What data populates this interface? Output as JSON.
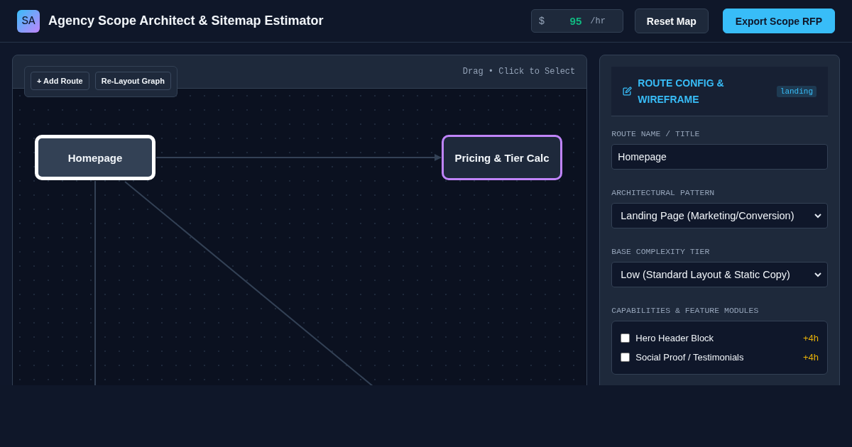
{
  "app": {
    "logo": "SA",
    "title": "Agency Scope Architect & Sitemap Estimator"
  },
  "rate": {
    "currency": "$",
    "value": "95",
    "unit": "/hr"
  },
  "header_buttons": [
    {
      "label": "Reset Map",
      "kind": "secondary"
    },
    {
      "label": "Export Scope RFP",
      "kind": "primary"
    }
  ],
  "canvas": {
    "hint": "Drag • Click to Select",
    "toolbar": [
      "+ Add Route",
      "Re-Layout Graph"
    ],
    "nodes": [
      {
        "label": "Homepage",
        "selected": true,
        "color": "#334155"
      },
      {
        "label": "Pricing & Tier Calc",
        "selected": false,
        "color": "#c084fc"
      }
    ]
  },
  "config": {
    "title": "ROUTE CONFIG & WIREFRAME",
    "badge": "landing",
    "fields": [
      {
        "label": "ROUTE NAME / TITLE",
        "kind": "text",
        "value": "Homepage"
      },
      {
        "label": "ARCHITECTURAL PATTERN",
        "kind": "select",
        "value": "Landing Page (Marketing/Conversion)"
      },
      {
        "label": "BASE COMPLEXITY TIER",
        "kind": "select",
        "value": "Low (Standard Layout & Static Copy)"
      }
    ],
    "modules_label": "CAPABILITIES & FEATURE MODULES",
    "modules": [
      {
        "label": "Hero Header Block",
        "hours": "+4h",
        "checked": false
      },
      {
        "label": "Social Proof / Testimonials",
        "hours": "+4h",
        "checked": false
      }
    ]
  }
}
